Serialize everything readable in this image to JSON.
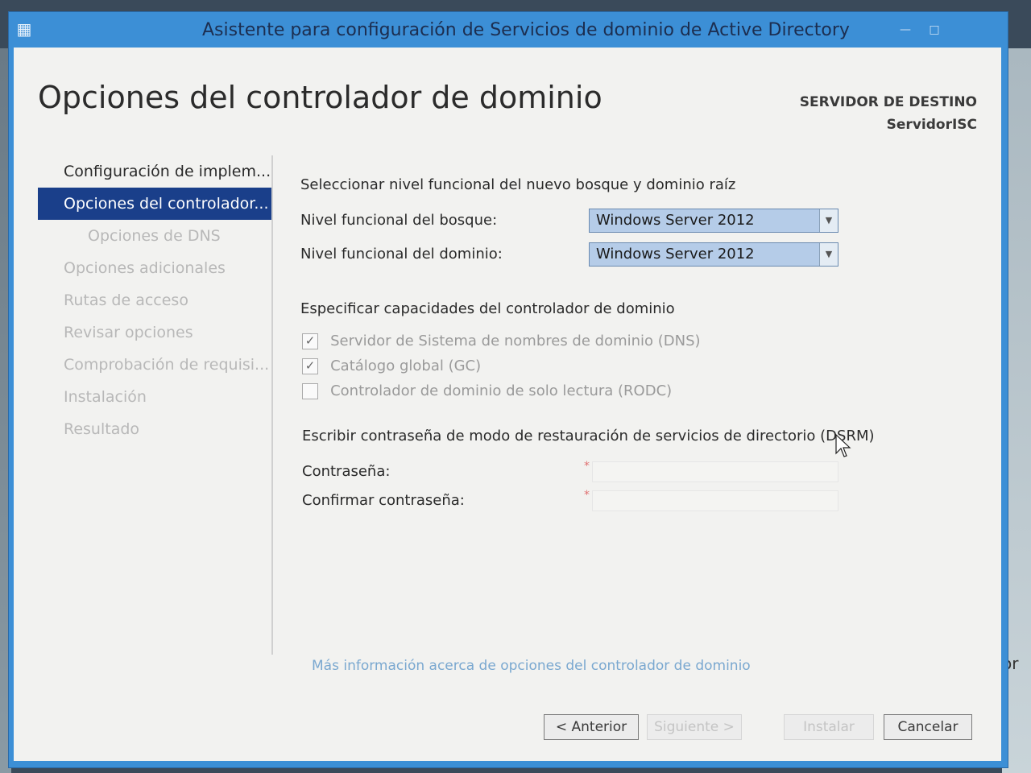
{
  "window": {
    "title": "Asistente para configuración de Servicios de dominio de Active Directory"
  },
  "header": {
    "page_title": "Opciones del controlador de dominio",
    "destination_label": "SERVIDOR DE DESTINO",
    "destination_server": "ServidorISC"
  },
  "sidebar": {
    "items": [
      {
        "label": "Configuración de implem...",
        "state": "done"
      },
      {
        "label": "Opciones del controlador...",
        "state": "active"
      },
      {
        "label": "Opciones de DNS",
        "state": "sub"
      },
      {
        "label": "Opciones adicionales",
        "state": "pending"
      },
      {
        "label": "Rutas de acceso",
        "state": "pending"
      },
      {
        "label": "Revisar opciones",
        "state": "pending"
      },
      {
        "label": "Comprobación de requisi...",
        "state": "pending"
      },
      {
        "label": "Instalación",
        "state": "pending"
      },
      {
        "label": "Resultado",
        "state": "pending"
      }
    ]
  },
  "functional_level": {
    "section_title": "Seleccionar nivel funcional del nuevo bosque y dominio raíz",
    "forest_label": "Nivel funcional del bosque:",
    "forest_value": "Windows Server 2012",
    "domain_label": "Nivel funcional del dominio:",
    "domain_value": "Windows Server 2012"
  },
  "capabilities": {
    "section_title": "Especificar capacidades del controlador de dominio",
    "options": [
      {
        "label": "Servidor de Sistema de nombres de dominio (DNS)",
        "checked": true
      },
      {
        "label": "Catálogo global (GC)",
        "checked": true
      },
      {
        "label": "Controlador de dominio de solo lectura (RODC)",
        "checked": false
      }
    ]
  },
  "dsrm": {
    "section_title": "Escribir contraseña de modo de restauración de servicios de directorio (DSRM)",
    "password_label": "Contraseña:",
    "confirm_label": "Confirmar contraseña:",
    "required_mark": "*"
  },
  "more_info_link": "Más información acerca de opciones del controlador de dominio",
  "buttons": {
    "previous": "< Anterior",
    "next": "Siguiente >",
    "install": "Instalar",
    "cancel": "Cancelar"
  },
  "background": {
    "right_text": "or l"
  },
  "colors": {
    "title_bar": "#3c8fd6",
    "nav_active": "#1a3f8a",
    "combo_fill": "#b5cce8",
    "link": "#7aa8d0"
  }
}
